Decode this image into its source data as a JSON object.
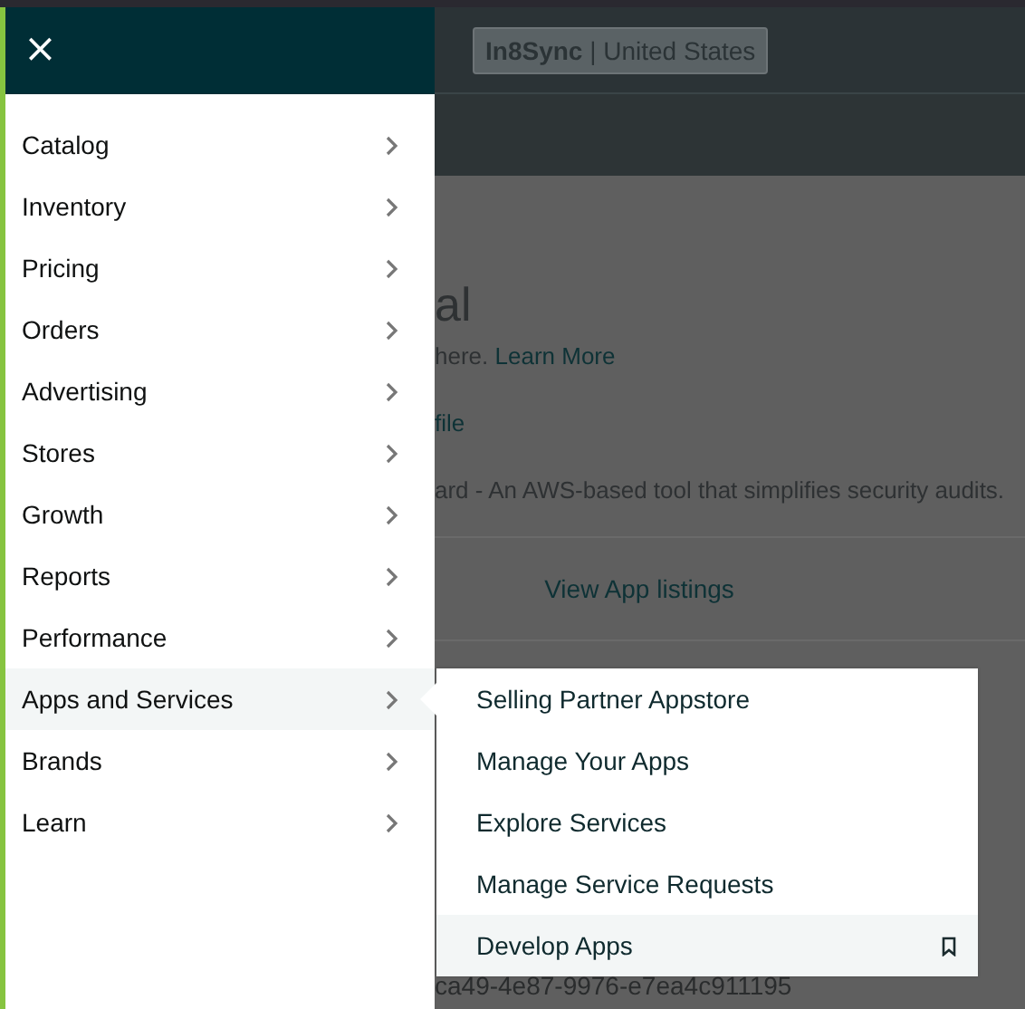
{
  "background": {
    "account_badge": {
      "store": "In8Sync",
      "separator": "|",
      "region": "United States"
    },
    "heading": "al",
    "intro": {
      "text": "here.",
      "link": "Learn More"
    },
    "profile_link": "file",
    "notice": "ard - An AWS-based tool that simplifies security audits.",
    "listings_link": "View App listings",
    "id_text": "ca49-4e87-9976-e7ea4c911195"
  },
  "menu": {
    "close": "×",
    "items": [
      {
        "label": "Catalog",
        "selected": false
      },
      {
        "label": "Inventory",
        "selected": false
      },
      {
        "label": "Pricing",
        "selected": false
      },
      {
        "label": "Orders",
        "selected": false
      },
      {
        "label": "Advertising",
        "selected": false
      },
      {
        "label": "Stores",
        "selected": false
      },
      {
        "label": "Growth",
        "selected": false
      },
      {
        "label": "Reports",
        "selected": false
      },
      {
        "label": "Performance",
        "selected": false
      },
      {
        "label": "Apps and Services",
        "selected": true
      },
      {
        "label": "Brands",
        "selected": false
      },
      {
        "label": "Learn",
        "selected": false
      }
    ]
  },
  "submenu": {
    "items": [
      {
        "label": "Selling Partner Appstore",
        "hovered": false
      },
      {
        "label": "Manage Your Apps",
        "hovered": false
      },
      {
        "label": "Explore Services",
        "hovered": false
      },
      {
        "label": "Manage Service Requests",
        "hovered": false
      },
      {
        "label": "Develop Apps",
        "hovered": true
      }
    ]
  }
}
